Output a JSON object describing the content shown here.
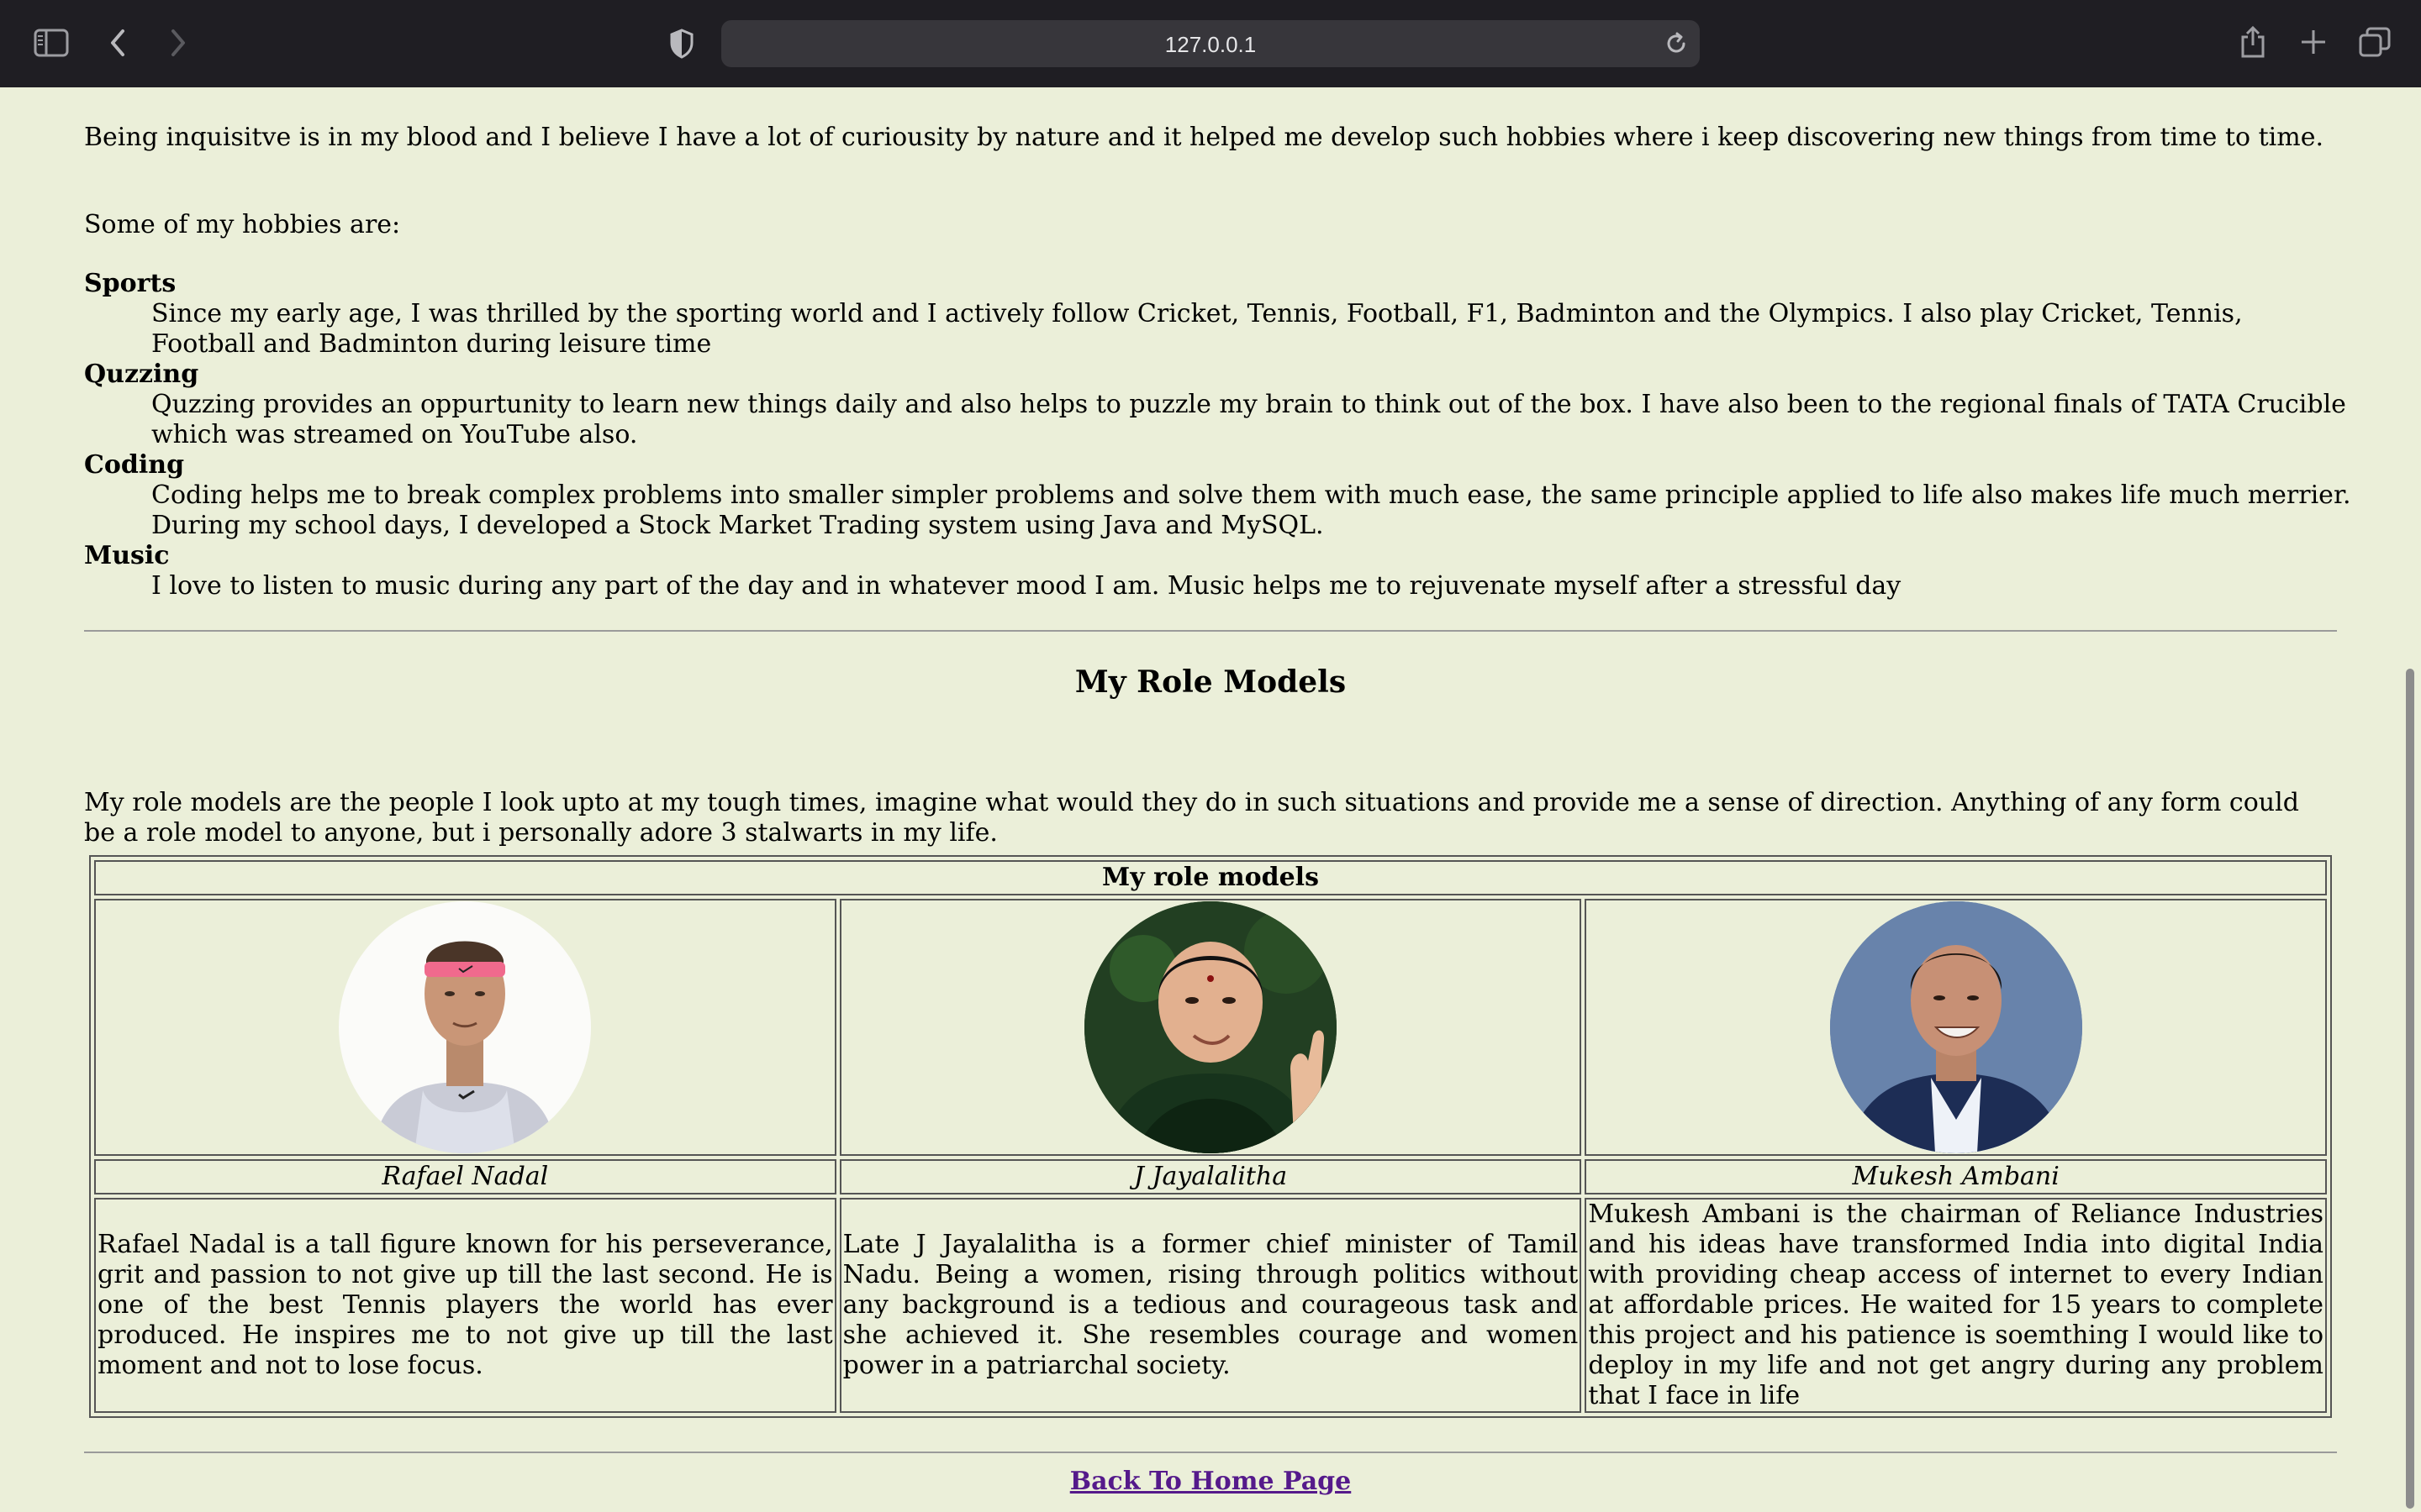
{
  "browser": {
    "url": "127.0.0.1",
    "icons": [
      "sidebar-icon",
      "back-icon",
      "forward-icon",
      "privacy-shield-icon",
      "reload-icon",
      "share-icon",
      "new-tab-icon",
      "tab-overview-icon"
    ]
  },
  "intro": {
    "paragraph": "Being inquisitve is in my blood and I believe I have a lot of curiousity by nature and it helped me develop such hobbies where i keep discovering new things from time to time.",
    "hobbies_lead": "Some of my hobbies are:"
  },
  "hobbies": [
    {
      "term": "Sports",
      "desc": "Since my early age, I was thrilled by the sporting world and I actively follow Cricket, Tennis, Football, F1, Badminton and the Olympics. I also play Cricket, Tennis, Football and Badminton during leisure time"
    },
    {
      "term": "Quzzing",
      "desc": "Quzzing provides an oppurtunity to learn new things daily and also helps to puzzle my brain to think out of the box. I have also been to the regional finals of TATA Crucible which was streamed on YouTube also."
    },
    {
      "term": "Coding",
      "desc": "Coding helps me to break complex problems into smaller simpler problems and solve them with much ease, the same principle applied to life also makes life much merrier. During my school days, I developed a Stock Market Trading system using Java and MySQL."
    },
    {
      "term": "Music",
      "desc": "I love to listen to music during any part of the day and in whatever mood I am. Music helps me to rejuvenate myself after a stressful day"
    }
  ],
  "role_models": {
    "heading": "My Role Models",
    "intro": "My role models are the people I look upto at my tough times, imagine what would they do in such situations and provide me a sense of direction. Anything of any form could be a role model to anyone, but i personally adore 3 stalwarts in my life.",
    "table_caption": "My role models",
    "people": [
      {
        "name": "Rafael Nadal",
        "desc": "Rafael Nadal is a tall figure known for his perseverance, grit and passion to not give up till the last second. He is one of the best Tennis players the world has ever produced. He inspires me to not give up till the last moment and not to lose focus."
      },
      {
        "name": "J Jayalalitha",
        "desc": "Late J Jayalalitha is a former chief minister of Tamil Nadu. Being a women, rising through politics without any background is a tedious and courageous task and she achieved it. She resembles courage and women power in a patriarchal society."
      },
      {
        "name": "Mukesh Ambani",
        "desc": "Mukesh Ambani is the chairman of Reliance Industries and his ideas have transformed India into digital India with providing cheap access of internet to every Indian at affordable prices. He waited for 15 years to complete this project and his patience is soemthing I would like to deploy in my life and not get angry during any problem that I face in life"
      }
    ]
  },
  "footer": {
    "back_link": "Back To Home Page"
  },
  "colors": {
    "page_background": "#ebefd9",
    "link": "#551a8b",
    "chrome": "#1f1e23"
  }
}
